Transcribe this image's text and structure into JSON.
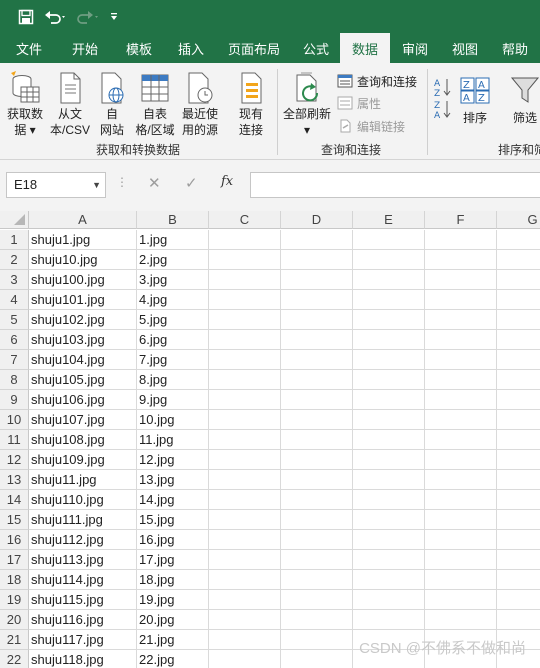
{
  "quick_access": {
    "save_icon": "save-icon",
    "undo_icon": "undo-icon",
    "redo_icon": "redo-icon",
    "customize_icon": "customize-arrow-icon"
  },
  "tabs": [
    {
      "label": "文件"
    },
    {
      "label": "开始"
    },
    {
      "label": "模板"
    },
    {
      "label": "插入"
    },
    {
      "label": "页面布局"
    },
    {
      "label": "公式"
    },
    {
      "label": "数据",
      "active": true
    },
    {
      "label": "审阅"
    },
    {
      "label": "视图"
    },
    {
      "label": "帮助"
    }
  ],
  "ribbon": {
    "get_data": "获取数\n据 ▾",
    "from_text": "从文\n本/CSV",
    "from_web": "自\n网站",
    "from_table": "自表\n格/区域",
    "recent_sources": "最近使\n用的源",
    "existing_connections": "现有\n连接",
    "group_get_transform": "获取和转换数据",
    "refresh_all": "全部刷新\n▾",
    "queries_connections": "查询和连接",
    "properties": "属性",
    "edit_links": "编辑链接",
    "group_queries": "查询和连接",
    "sort": "排序",
    "filter": "筛选",
    "group_sort_filter": "排序和筛"
  },
  "formula_bar": {
    "name_box": "E18",
    "fx_label": "fx",
    "formula": ""
  },
  "sheet": {
    "columns": [
      "A",
      "B",
      "C",
      "D",
      "E",
      "F",
      "G"
    ],
    "rows": [
      {
        "n": "1",
        "a": "shuju1.jpg",
        "b": "1.jpg"
      },
      {
        "n": "2",
        "a": "shuju10.jpg",
        "b": "2.jpg"
      },
      {
        "n": "3",
        "a": "shuju100.jpg",
        "b": "3.jpg"
      },
      {
        "n": "4",
        "a": "shuju101.jpg",
        "b": "4.jpg"
      },
      {
        "n": "5",
        "a": "shuju102.jpg",
        "b": "5.jpg"
      },
      {
        "n": "6",
        "a": "shuju103.jpg",
        "b": "6.jpg"
      },
      {
        "n": "7",
        "a": "shuju104.jpg",
        "b": "7.jpg"
      },
      {
        "n": "8",
        "a": "shuju105.jpg",
        "b": "8.jpg"
      },
      {
        "n": "9",
        "a": "shuju106.jpg",
        "b": "9.jpg"
      },
      {
        "n": "10",
        "a": "shuju107.jpg",
        "b": "10.jpg"
      },
      {
        "n": "11",
        "a": "shuju108.jpg",
        "b": "11.jpg"
      },
      {
        "n": "12",
        "a": "shuju109.jpg",
        "b": "12.jpg"
      },
      {
        "n": "13",
        "a": "shuju11.jpg",
        "b": "13.jpg"
      },
      {
        "n": "14",
        "a": "shuju110.jpg",
        "b": "14.jpg"
      },
      {
        "n": "15",
        "a": "shuju111.jpg",
        "b": "15.jpg"
      },
      {
        "n": "16",
        "a": "shuju112.jpg",
        "b": "16.jpg"
      },
      {
        "n": "17",
        "a": "shuju113.jpg",
        "b": "17.jpg"
      },
      {
        "n": "18",
        "a": "shuju114.jpg",
        "b": "18.jpg"
      },
      {
        "n": "19",
        "a": "shuju115.jpg",
        "b": "19.jpg"
      },
      {
        "n": "20",
        "a": "shuju116.jpg",
        "b": "20.jpg"
      },
      {
        "n": "21",
        "a": "shuju117.jpg",
        "b": "21.jpg"
      },
      {
        "n": "22",
        "a": "shuju118.jpg",
        "b": "22.jpg"
      }
    ]
  },
  "watermark": "CSDN @不佛系不做和尚",
  "colors": {
    "brand": "#217346",
    "ribbon_bg": "#f3f3f3",
    "header_bg": "#f0f0f0"
  }
}
